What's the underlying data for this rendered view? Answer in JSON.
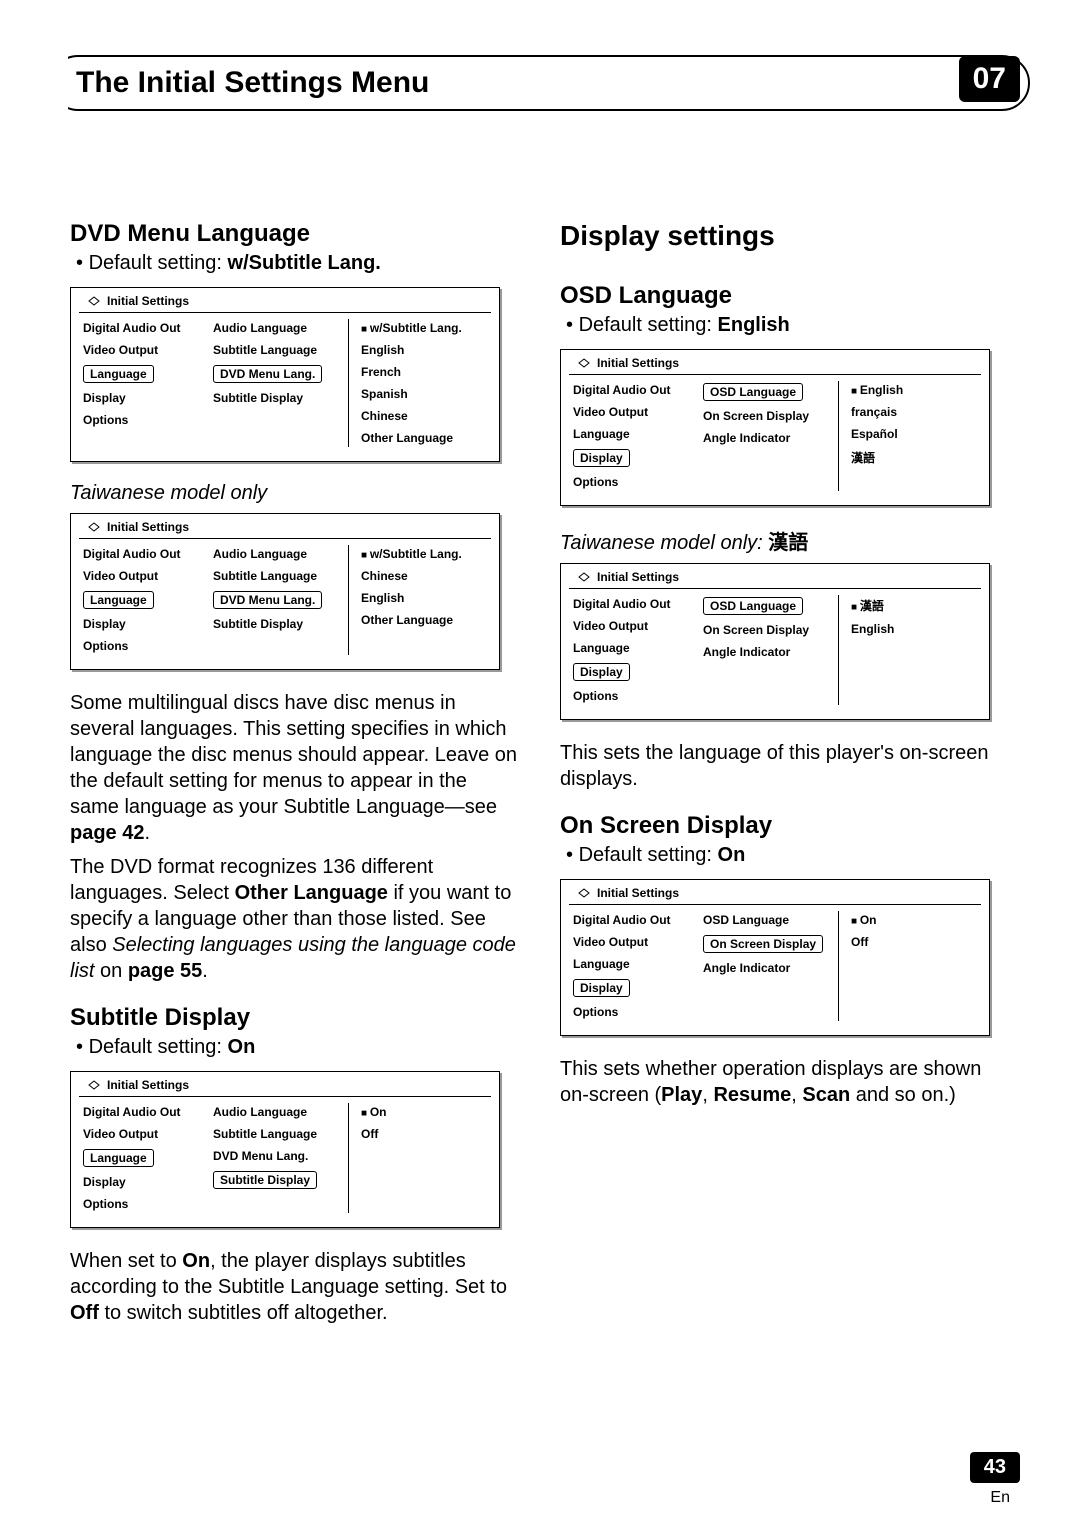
{
  "header": {
    "title": "The Initial Settings Menu",
    "chapter": "07"
  },
  "footer": {
    "page": "43",
    "lang": "En"
  },
  "left": {
    "sec1": {
      "heading": "DVD Menu Language",
      "bullet_prefix": "Default setting: ",
      "bullet_bold": "w/Subtitle Lang."
    },
    "osd1": {
      "title": "Initial Settings",
      "col1": [
        "Digital Audio Out",
        "Video Output",
        "Language",
        "Display",
        "Options"
      ],
      "col1_selected": "Language",
      "col2": [
        "Audio Language",
        "Subtitle Language",
        "DVD Menu Lang.",
        "Subtitle Display"
      ],
      "col2_selected": "DVD Menu Lang.",
      "col3": [
        "w/Subtitle Lang.",
        "English",
        "French",
        "Spanish",
        "Chinese",
        "Other Language"
      ],
      "col3_marked": "w/Subtitle Lang."
    },
    "note1": "Taiwanese model only",
    "osd2": {
      "title": "Initial Settings",
      "col1": [
        "Digital Audio Out",
        "Video Output",
        "Language",
        "Display",
        "Options"
      ],
      "col1_selected": "Language",
      "col2": [
        "Audio Language",
        "Subtitle Language",
        "DVD Menu Lang.",
        "Subtitle Display"
      ],
      "col2_selected": "DVD Menu Lang.",
      "col3": [
        "w/Subtitle Lang.",
        "Chinese",
        "English",
        "Other Language"
      ],
      "col3_marked": "w/Subtitle Lang."
    },
    "para1_a": "Some multilingual discs have disc menus in several languages. This setting specifies in which language the disc menus should appear. Leave on the default setting for menus to appear in the same language as your Subtitle Language—see ",
    "para1_b": "page 42",
    "para1_c": ".",
    "para2_a": "The DVD format recognizes 136 different languages. Select ",
    "para2_b": "Other Language",
    "para2_c": " if you want to specify a language other than those listed. See also ",
    "para2_d": "Selecting languages using the language code list",
    "para2_e": " on ",
    "para2_f": "page 55",
    "para2_g": ".",
    "sec2": {
      "heading": "Subtitle Display",
      "bullet_prefix": "Default setting: ",
      "bullet_bold": "On"
    },
    "osd3": {
      "title": "Initial Settings",
      "col1": [
        "Digital Audio Out",
        "Video Output",
        "Language",
        "Display",
        "Options"
      ],
      "col1_selected": "Language",
      "col2": [
        "Audio Language",
        "Subtitle Language",
        "DVD Menu Lang.",
        "Subtitle Display"
      ],
      "col2_selected": "Subtitle Display",
      "col3": [
        "On",
        "Off"
      ],
      "col3_marked": "On"
    },
    "para3_a": "When set to ",
    "para3_b": "On",
    "para3_c": ", the player displays subtitles according to the Subtitle Language setting. Set to ",
    "para3_d": "Off",
    "para3_e": " to switch subtitles off altogether."
  },
  "right": {
    "big_heading": "Display settings",
    "sec1": {
      "heading": "OSD Language",
      "bullet_prefix": "Default setting: ",
      "bullet_bold": "English"
    },
    "osd1": {
      "title": "Initial Settings",
      "col1": [
        "Digital Audio Out",
        "Video Output",
        "Language",
        "Display",
        "Options"
      ],
      "col1_selected": "Display",
      "col2": [
        "OSD Language",
        "On Screen Display",
        "Angle Indicator"
      ],
      "col2_selected": "OSD Language",
      "col3": [
        "English",
        "français",
        "Español",
        "漢語"
      ],
      "col3_marked": "English"
    },
    "note1_a": "Taiwanese model only: ",
    "note1_b": "漢語",
    "osd2": {
      "title": "Initial Settings",
      "col1": [
        "Digital Audio Out",
        "Video Output",
        "Language",
        "Display",
        "Options"
      ],
      "col1_selected": "Display",
      "col2": [
        "OSD Language",
        "On Screen Display",
        "Angle Indicator"
      ],
      "col2_selected": "OSD Language",
      "col3": [
        "漢語",
        "English"
      ],
      "col3_marked": "漢語"
    },
    "para1": "This sets the language of this player's on-screen displays.",
    "sec2": {
      "heading": "On Screen Display",
      "bullet_prefix": "Default setting: ",
      "bullet_bold": "On"
    },
    "osd3": {
      "title": "Initial Settings",
      "col1": [
        "Digital Audio Out",
        "Video Output",
        "Language",
        "Display",
        "Options"
      ],
      "col1_selected": "Display",
      "col2": [
        "OSD Language",
        "On Screen Display",
        "Angle Indicator"
      ],
      "col2_selected": "On Screen Display",
      "col3": [
        "On",
        "Off"
      ],
      "col3_marked": "On"
    },
    "para2_a": "This sets whether operation displays are shown on-screen (",
    "para2_b": "Play",
    "para2_c": ", ",
    "para2_d": "Resume",
    "para2_e": ", ",
    "para2_f": "Scan",
    "para2_g": " and so on.)"
  }
}
